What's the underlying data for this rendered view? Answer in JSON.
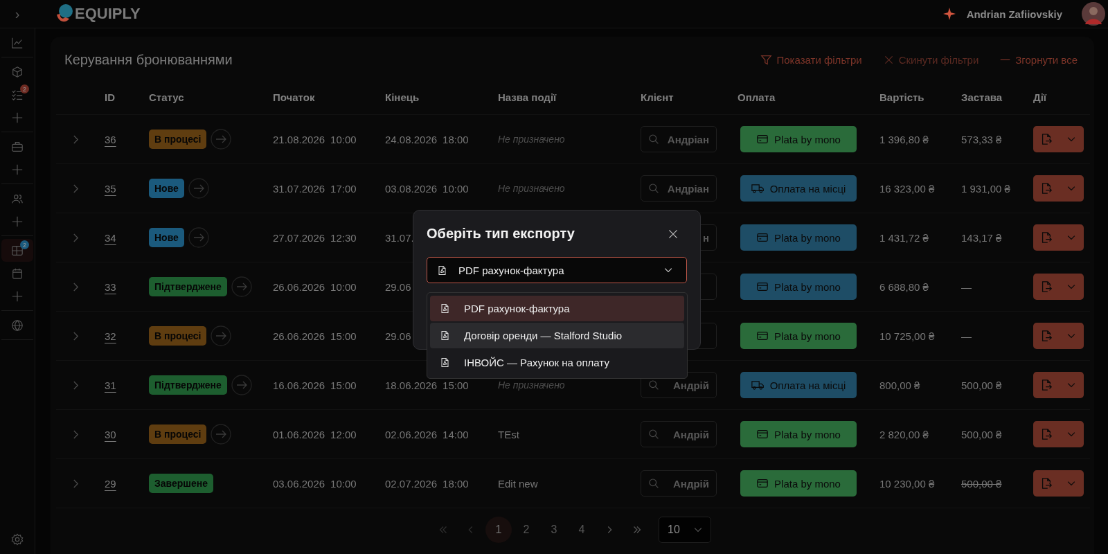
{
  "topbar": {
    "toggle": "›",
    "logo": "EQUIPLY",
    "user": "Andrian Zafiiovskiy"
  },
  "sidebar": {
    "groups": [
      [
        {
          "kind": "chart",
          "active": false
        }
      ],
      [
        {
          "kind": "box",
          "active": false
        },
        {
          "kind": "checklist",
          "active": false,
          "badge": "2",
          "color": "#6e2b22"
        },
        {
          "kind": "plus",
          "active": false
        }
      ],
      [
        {
          "kind": "briefcase",
          "active": false
        },
        {
          "kind": "plus",
          "active": false
        }
      ],
      [
        {
          "kind": "people",
          "active": false
        },
        {
          "kind": "plus",
          "active": false
        }
      ],
      [
        {
          "kind": "grid",
          "active": true,
          "badge": "2",
          "color": "#1b5a7d"
        },
        {
          "kind": "calendar",
          "active": false
        },
        {
          "kind": "plus",
          "active": false
        }
      ],
      [
        {
          "kind": "globe",
          "active": false
        }
      ]
    ],
    "footer": {
      "kind": "settings",
      "active": false
    }
  },
  "page": {
    "title": "Керування бронюваннями",
    "actions": [
      {
        "kind": "filter",
        "label": "Показати фільтри",
        "disabled": false
      },
      {
        "kind": "close",
        "label": "Скинути фільтри",
        "disabled": true
      },
      {
        "kind": "minus",
        "label": "Згорнути все",
        "disabled": false
      }
    ]
  },
  "table": {
    "columns": [
      "ID",
      "Статус",
      "Початок",
      "Кінець",
      "Назва події",
      "Клієнт",
      "Оплата",
      "Вартість",
      "Застава",
      "Дії"
    ],
    "rows": [
      {
        "id": "36",
        "status": {
          "label": "В процесі",
          "color": "#5f3d10"
        },
        "arrow": true,
        "start_date": "21.08.2026",
        "start_time": "10:00",
        "end_date": "24.08.2026",
        "end_time": "18:00",
        "event": "Не призначено",
        "event_unset": true,
        "client": "Андріан",
        "search_icon": true,
        "payment": {
          "label": "Plata by mono",
          "kind": "card",
          "color": "#2a6b3a"
        },
        "cost": "1 396,80 ₴",
        "deposit": "573,33 ₴",
        "struck": false
      },
      {
        "id": "35",
        "status": {
          "label": "Нове",
          "color": "#1b5a7d"
        },
        "arrow": true,
        "start_date": "31.07.2026",
        "start_time": "17:00",
        "end_date": "03.08.2026",
        "end_time": "10:00",
        "event": "Не призначено",
        "event_unset": true,
        "client": "Андріан",
        "search_icon": true,
        "payment": {
          "label": "Оплата на місці",
          "kind": "truck",
          "color": "#1e4d66"
        },
        "cost": "16 323,00 ₴",
        "deposit": "1 931,00 ₴",
        "struck": false
      },
      {
        "id": "34",
        "status": {
          "label": "Нове",
          "color": "#1b5a7d"
        },
        "arrow": true,
        "start_date": "27.07.2026",
        "start_time": "12:30",
        "end_date": "31.07.",
        "client": "н",
        "search_icon": false,
        "payment": {
          "label": "Plata by mono",
          "kind": "card",
          "color": "#1e4d66"
        },
        "cost": "1 431,72 ₴",
        "deposit": "143,17 ₴",
        "struck": false
      },
      {
        "id": "33",
        "status": {
          "label": "Підтверджене",
          "color": "#1d5e2f"
        },
        "arrow": true,
        "start_date": "26.06.2026",
        "start_time": "10:00",
        "end_date": "29.06",
        "search_icon": false,
        "payment": {
          "label": "Plata by mono",
          "kind": "card",
          "color": "#1e4d66"
        },
        "cost": "6 688,80 ₴",
        "deposit": "—",
        "struck": false
      },
      {
        "id": "32",
        "status": {
          "label": "В процесі",
          "color": "#5f3d10"
        },
        "arrow": true,
        "start_date": "26.06.2026",
        "start_time": "15:00",
        "end_date": "29.06",
        "search_icon": false,
        "payment": {
          "label": "Plata by mono",
          "kind": "card",
          "color": "#2a6b3a"
        },
        "cost": "10 725,00 ₴",
        "deposit": "—",
        "struck": false
      },
      {
        "id": "31",
        "status": {
          "label": "Підтверджене",
          "color": "#1d5e2f"
        },
        "arrow": true,
        "start_date": "16.06.2026",
        "start_time": "15:00",
        "end_date": "18.06.2026",
        "end_time": "15:00",
        "event": "Не призначено",
        "event_unset": true,
        "client": "Андрій",
        "search_icon": true,
        "payment": {
          "label": "Оплата на місці",
          "kind": "truck",
          "color": "#1e4d66"
        },
        "cost": "800,00 ₴",
        "deposit": "500,00 ₴",
        "struck": false
      },
      {
        "id": "30",
        "status": {
          "label": "В процесі",
          "color": "#5f3d10"
        },
        "arrow": true,
        "start_date": "01.06.2026",
        "start_time": "12:00",
        "end_date": "02.06.2026",
        "end_time": "14:00",
        "event": "TEst",
        "event_unset": false,
        "client": "Андрій",
        "search_icon": true,
        "payment": {
          "label": "Plata by mono",
          "kind": "card",
          "color": "#2a6b3a"
        },
        "cost": "2 820,00 ₴",
        "deposit": "500,00 ₴",
        "struck": false
      },
      {
        "id": "29",
        "status": {
          "label": "Завершене",
          "color": "#1d5e2f"
        },
        "arrow": false,
        "start_date": "03.06.2026",
        "start_time": "10:00",
        "end_date": "02.07.2026",
        "end_time": "18:00",
        "event": "Edit new",
        "event_unset": false,
        "client": "Андрій",
        "search_icon": true,
        "payment": {
          "label": "Plata by mono",
          "kind": "card",
          "color": "#2a6b3a"
        },
        "cost": "10 230,00 ₴",
        "deposit": "500,00 ₴",
        "struck": true
      }
    ]
  },
  "pagination": {
    "first_disabled": true,
    "prev_disabled": true,
    "pages": [
      {
        "label": "1",
        "selected": true
      },
      {
        "label": "2",
        "selected": false
      },
      {
        "label": "3",
        "selected": false
      },
      {
        "label": "4",
        "selected": false
      }
    ],
    "page_size": "10"
  },
  "modal": {
    "title": "Оберіть тип експорту",
    "value": "PDF рахунок-фактура",
    "options": [
      {
        "label": "PDF рахунок-фактура",
        "selected": true,
        "hovered": false
      },
      {
        "label": "Договір оренди — Stalford Studio",
        "selected": false,
        "hovered": true
      },
      {
        "label": "ІНВОЙС — Рахунок на оплату",
        "selected": false,
        "hovered": false
      }
    ]
  }
}
